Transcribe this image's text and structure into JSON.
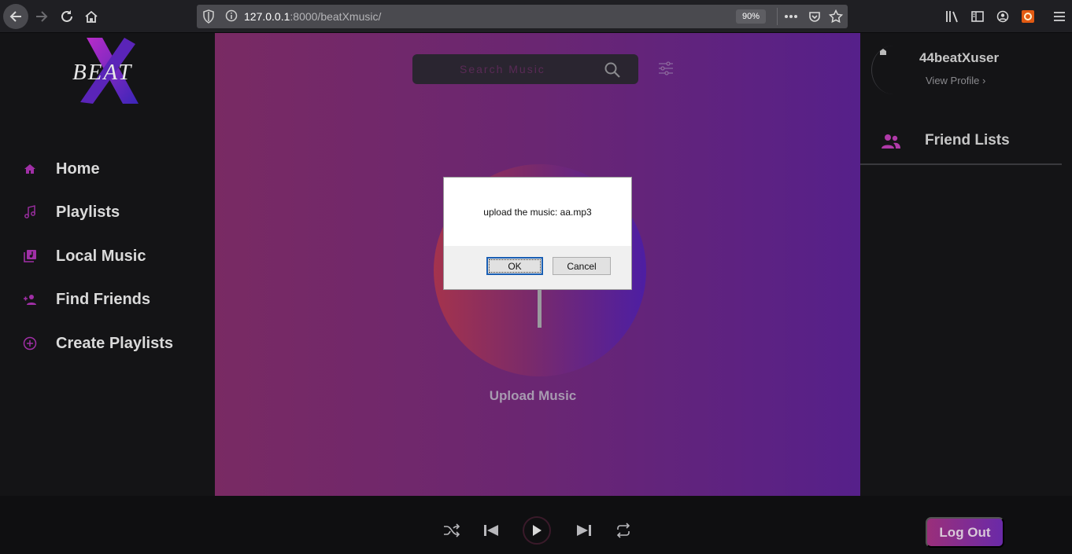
{
  "browser": {
    "url_host": "127.0.0.1",
    "url_rest": ":8000/beatXmusic/",
    "zoom": "90%"
  },
  "sidebar": {
    "logo_text": "BEAT",
    "items": [
      {
        "label": "Home",
        "icon": "home-icon"
      },
      {
        "label": "Playlists",
        "icon": "music-note-icon"
      },
      {
        "label": "Local Music",
        "icon": "library-music-icon"
      },
      {
        "label": "Find Friends",
        "icon": "person-add-icon"
      },
      {
        "label": "Create Playlists",
        "icon": "add-circle-icon"
      }
    ]
  },
  "main": {
    "search_placeholder": "Search Music",
    "upload_label": "Upload Music"
  },
  "dialog": {
    "message": "upload the music: aa.mp3",
    "ok_label": "OK",
    "cancel_label": "Cancel"
  },
  "profile": {
    "username": "44beatXuser",
    "view_profile": "View Profile ›",
    "friends_title": "Friend Lists"
  },
  "player": {
    "logout_label": "Log Out"
  },
  "colors": {
    "accent": "#a02fa6",
    "main_gradient_start": "#792a63",
    "main_gradient_end": "#56208a"
  }
}
